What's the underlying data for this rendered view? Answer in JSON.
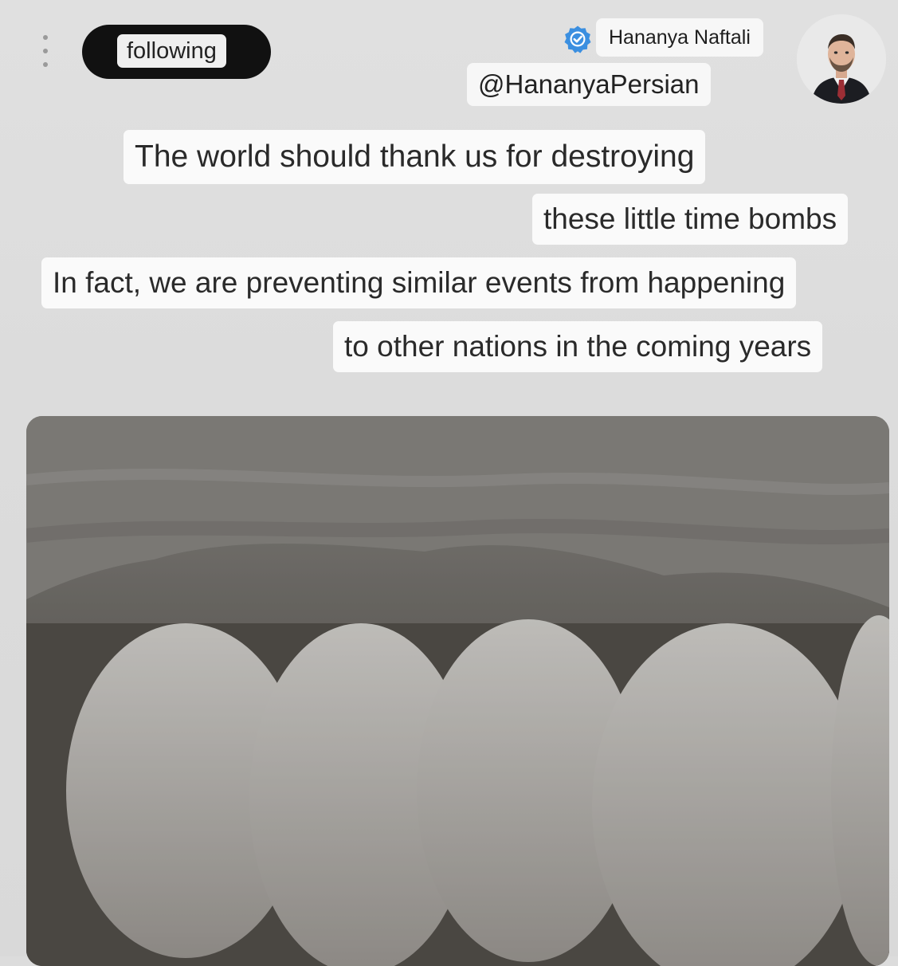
{
  "header": {
    "follow_button_label": "following",
    "display_name": "Hananya Naftali",
    "handle": "@HananyaPersian"
  },
  "post": {
    "lines": [
      "The world should thank us for destroying",
      "these little time bombs",
      "In fact, we are preventing similar events from happening",
      "to other nations in the coming years"
    ]
  },
  "icons": {
    "more": "more-vertical-icon",
    "verified": "verified-badge-icon"
  },
  "colors": {
    "background": "#dcdcdc",
    "text_box": "#fafafa",
    "follow_button": "#111111",
    "verified_blue": "#3b8fe0"
  }
}
